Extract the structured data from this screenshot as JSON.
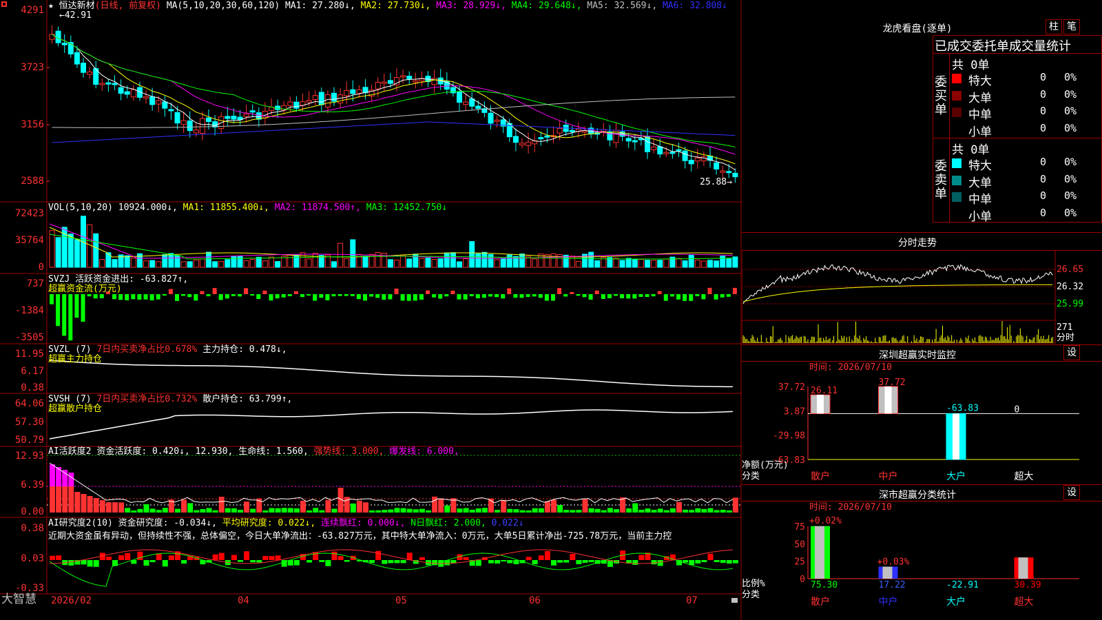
{
  "stock": {
    "name": "恒达新材",
    "mode": "(日线, 前复权)",
    "star_icon": "star-icon",
    "high_marker": "42.91",
    "low_marker": "25.88"
  },
  "ma_line": {
    "label": "MA(5,10,20,30,60,120)",
    "items": [
      {
        "name": "MA1:",
        "value": "27.280↓,",
        "color": "#ffffff"
      },
      {
        "name": "MA2:",
        "value": "27.730↓,",
        "color": "#ffff00"
      },
      {
        "name": "MA3:",
        "value": "28.929↓,",
        "color": "#ff00ff"
      },
      {
        "name": "MA4:",
        "value": "29.648↓,",
        "color": "#00ff00"
      },
      {
        "name": "MA5:",
        "value": "32.569↓,",
        "color": "#c0c0c0"
      },
      {
        "name": "MA6:",
        "value": "32.808↓",
        "color": "#3030ff"
      }
    ]
  },
  "price_axis": [
    "4291",
    "3723",
    "3156",
    "2588"
  ],
  "volume": {
    "label": "VOL(5,10,20)",
    "value": "10924.000↓,",
    "ma1": "MA1: 11855.400↓,",
    "ma2": "MA2: 11874.500↑,",
    "ma3": "MA3: 12452.750↓",
    "axis": [
      "72423",
      "35764",
      "0"
    ]
  },
  "svzj": {
    "label": "SVZJ",
    "text": "活跃资金进出: -63.827↑,",
    "sub": "超赢资金流(万元)",
    "axis": [
      "737",
      "-1384",
      "-3505"
    ]
  },
  "svzl": {
    "label": "SVZL (7)",
    "text1": "7日内买卖净占比0.678%",
    "text2": "主力持仓: 0.478↓,",
    "sub": "超赢主力持仓",
    "axis": [
      "11.95",
      "6.17",
      "0.38"
    ]
  },
  "svsh": {
    "label": "SVSH (7)",
    "text1": "7日内买卖净占比0.732%",
    "text2": "散户持仓: 63.799↑,",
    "sub": "超赢散户持仓",
    "axis": [
      "64.06",
      "57.30",
      "50.79"
    ]
  },
  "ai_active": {
    "label": "AI活跃度2",
    "t1": "资金活跃度: 0.420↓,",
    "t2": "12.930,",
    "t3": "生命线: 1.560,",
    "t4": "强势线: 3.000,",
    "t5": "爆发线: 6.000,",
    "axis": [
      "12.93",
      "6.39",
      "0.00"
    ]
  },
  "ai_research": {
    "label": "AI研究度2(10)",
    "t1": "资金研究度: -0.034↓,",
    "t2": "平均研究度: 0.022↓,",
    "t3": "连续飘红: 0.000↓,",
    "t4": "N日飘红: 2.000,",
    "t5": "0.022↓",
    "commentary": "近期大资金虽有异动，但持续性不强，总体偏空，今日大单净流出：-63.827万元，其中特大单净流入：0万元，大单5日累计净出-725.78万元，当前主力控",
    "axis": [
      "0.38",
      "0.03",
      "-0.33"
    ]
  },
  "date_axis": [
    "2026/02",
    "04",
    "05",
    "06",
    "07"
  ],
  "brand": "大智慧",
  "dragon_tiger": {
    "title": "龙虎看盘(逐单)",
    "btn1": "柱",
    "btn2": "笔",
    "subtitle": "已成交委托单成交量统计",
    "buy": {
      "side_label": "委买单",
      "total": "共 0单",
      "rows": [
        {
          "name": "特大",
          "count": "0",
          "pct": "0%",
          "color": "#ff0000"
        },
        {
          "name": "大单",
          "count": "0",
          "pct": "0%",
          "color": "#8b0000"
        },
        {
          "name": "中单",
          "count": "0",
          "pct": "0%",
          "color": "#5a0000"
        },
        {
          "name": "小单",
          "count": "0",
          "pct": "0%",
          "color": "#000000"
        }
      ]
    },
    "sell": {
      "side_label": "委卖单",
      "total": "共 0单",
      "rows": [
        {
          "name": "特大",
          "count": "0",
          "pct": "0%",
          "color": "#00ffff"
        },
        {
          "name": "大单",
          "count": "0",
          "pct": "0%",
          "color": "#008b8b"
        },
        {
          "name": "中单",
          "count": "0",
          "pct": "0%",
          "color": "#006060"
        },
        {
          "name": "小单",
          "count": "0",
          "pct": "0%",
          "color": "#000000"
        }
      ]
    }
  },
  "intraday": {
    "title": "分时走势",
    "axis": [
      "26.65",
      "26.32",
      "25.99"
    ],
    "vol_label": "271",
    "vol_sub": "分时"
  },
  "sz_monitor": {
    "title": "深圳超赢实时监控",
    "btn": "设",
    "time": "时间: 2026/07/10",
    "axis": [
      "37.72",
      "3.87",
      "-29.98",
      "-63.83"
    ],
    "y_label": "净额(万元)",
    "x_label": "分类",
    "categories": [
      "散户",
      "中户",
      "大户",
      "超大"
    ],
    "values": [
      "26.11",
      "37.72",
      "-63.83",
      "0"
    ]
  },
  "sz_classify": {
    "title": "深市超赢分类统计",
    "btn": "设",
    "time": "时间: 2026/07/10",
    "axis": [
      "75",
      "50",
      "25",
      "0"
    ],
    "y_label": "比例%",
    "x_label": "分类",
    "categories": [
      "散户",
      "中户",
      "大户",
      "超大"
    ],
    "top_labels": [
      "+0.02%",
      "+0.03%"
    ],
    "values": [
      "75.30",
      "17.22",
      "-22.91",
      "30.39"
    ]
  },
  "chart_data": [
    {
      "type": "bar",
      "title": "深圳超赢实时监控",
      "ylabel": "净额(万元)",
      "xlabel": "分类",
      "categories": [
        "散户",
        "中户",
        "大户",
        "超大"
      ],
      "values": [
        26.11,
        37.72,
        -63.83,
        0
      ],
      "ylim": [
        -63.83,
        37.72
      ]
    },
    {
      "type": "bar",
      "title": "深市超赢分类统计",
      "ylabel": "比例%",
      "xlabel": "分类",
      "categories": [
        "散户",
        "中户",
        "大户",
        "超大"
      ],
      "values": [
        75.3,
        17.22,
        -22.91,
        30.39
      ],
      "ylim": [
        0,
        75
      ]
    }
  ]
}
